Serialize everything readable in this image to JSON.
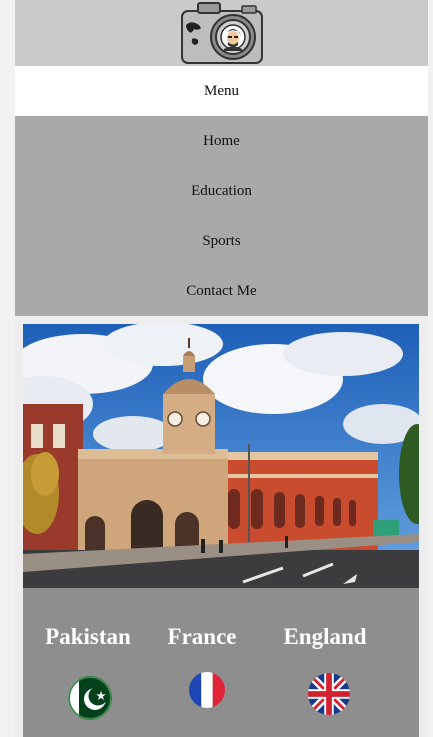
{
  "header": {
    "logo_icon": "camera-logo-icon"
  },
  "menu": {
    "label": "Menu"
  },
  "nav": {
    "items": [
      {
        "label": "Home"
      },
      {
        "label": "Education"
      },
      {
        "label": "Sports"
      },
      {
        "label": "Contact Me"
      }
    ]
  },
  "hero": {
    "image": "railway-station-clock-tower-photo"
  },
  "countries": [
    {
      "name": "Pakistan",
      "flag_icon": "pakistan-flag-icon"
    },
    {
      "name": "France",
      "flag_icon": "france-flag-icon"
    },
    {
      "name": "England",
      "flag_icon": "uk-flag-icon"
    }
  ],
  "colors": {
    "header_bg": "#cacaca",
    "menu_bg": "#ffffff",
    "nav_bg": "#a9a9a9",
    "countries_bg": "#8e8e8e"
  }
}
